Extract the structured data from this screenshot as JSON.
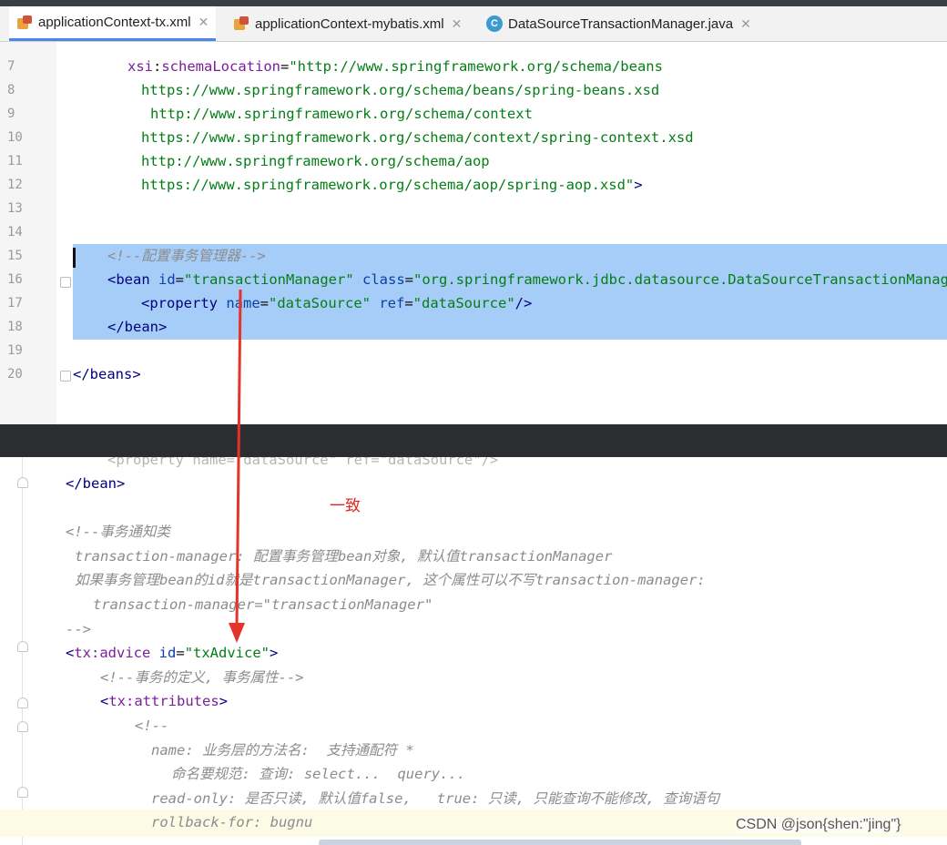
{
  "tabs": [
    {
      "label": "applicationContext-tx.xml",
      "icon": "xml-file-icon",
      "active": true
    },
    {
      "label": "applicationContext-mybatis.xml",
      "icon": "xml-file-icon",
      "active": false
    },
    {
      "label": "DataSourceTransactionManager.java",
      "icon": "java-class-icon",
      "active": false
    }
  ],
  "editor_top": {
    "lines": [
      {
        "num": "7",
        "parts": [
          [
            "c-ns",
            "xsi"
          ],
          [
            "c-pl",
            ":"
          ],
          [
            "c-ns",
            "schemaLocation"
          ],
          [
            "c-pl",
            "="
          ],
          [
            "c-val",
            "\"http://www.springframework.org/schema/beans"
          ]
        ]
      },
      {
        "num": "8",
        "parts": [
          [
            "c-val",
            "https://www.springframework.org/schema/beans/spring-beans.xsd"
          ]
        ]
      },
      {
        "num": "9",
        "parts": [
          [
            "c-val",
            "http://www.springframework.org/schema/context"
          ]
        ]
      },
      {
        "num": "10",
        "parts": [
          [
            "c-val",
            "https://www.springframework.org/schema/context/spring-context.xsd"
          ]
        ]
      },
      {
        "num": "11",
        "parts": [
          [
            "c-val",
            "http://www.springframework.org/schema/aop"
          ]
        ]
      },
      {
        "num": "12",
        "parts": [
          [
            "c-val",
            "https://www.springframework.org/schema/aop/spring-aop.xsd\""
          ],
          [
            "c-tag",
            ">"
          ]
        ]
      },
      {
        "num": "13",
        "parts": []
      },
      {
        "num": "14",
        "parts": []
      },
      {
        "num": "15",
        "parts": [
          [
            "c-com",
            "<!--配置事务管理器-->"
          ]
        ]
      },
      {
        "num": "16",
        "parts": [
          [
            "c-tag",
            "<bean "
          ],
          [
            "c-attr",
            "id"
          ],
          [
            "c-pl",
            "="
          ],
          [
            "c-val",
            "\"transactionManager\""
          ],
          [
            "c-pl",
            " "
          ],
          [
            "c-attr",
            "class"
          ],
          [
            "c-pl",
            "="
          ],
          [
            "c-val",
            "\"org.springframework.jdbc.datasource.DataSourceTransactionManager\""
          ]
        ]
      },
      {
        "num": "17",
        "parts": [
          [
            "c-tag",
            "<property "
          ],
          [
            "c-attr",
            "name"
          ],
          [
            "c-pl",
            "="
          ],
          [
            "c-val",
            "\"dataSource\""
          ],
          [
            "c-pl",
            " "
          ],
          [
            "c-attr",
            "ref"
          ],
          [
            "c-pl",
            "="
          ],
          [
            "c-val",
            "\"dataSource\""
          ],
          [
            "c-tag",
            "/>"
          ]
        ]
      },
      {
        "num": "18",
        "parts": [
          [
            "c-tag",
            "</bean>"
          ]
        ]
      },
      {
        "num": "19",
        "parts": []
      },
      {
        "num": "20",
        "parts": [
          [
            "c-tag",
            "</beans>"
          ]
        ]
      }
    ]
  },
  "editor_bottom": {
    "lines": [
      {
        "parts": [
          [
            "c-tag",
            "</bean>"
          ]
        ]
      },
      {
        "parts": []
      },
      {
        "parts": [
          [
            "c-com",
            "<!--事务通知类"
          ]
        ]
      },
      {
        "parts": [
          [
            "c-com",
            "transaction-manager: 配置事务管理bean对象, 默认值transactionManager"
          ]
        ]
      },
      {
        "parts": [
          [
            "c-com",
            "如果事务管理bean的id就是transactionManager, 这个属性可以不写transaction-manager:"
          ]
        ]
      },
      {
        "parts": [
          [
            "c-com",
            "transaction-manager=\"transactionManager\""
          ]
        ]
      },
      {
        "parts": [
          [
            "c-com",
            "-->"
          ]
        ]
      },
      {
        "parts": [
          [
            "c-tag",
            "<"
          ],
          [
            "c-ns",
            "tx:advice "
          ],
          [
            "c-attr",
            "id"
          ],
          [
            "c-pl",
            "="
          ],
          [
            "c-val",
            "\"txAdvice\""
          ],
          [
            "c-tag",
            ">"
          ]
        ]
      },
      {
        "parts": [
          [
            "c-com",
            "<!--事务的定义, 事务属性-->"
          ]
        ]
      },
      {
        "parts": [
          [
            "c-tag",
            "<"
          ],
          [
            "c-ns",
            "tx:attributes"
          ],
          [
            "c-tag",
            ">"
          ]
        ]
      },
      {
        "parts": [
          [
            "c-com",
            "<!--"
          ]
        ]
      },
      {
        "parts": [
          [
            "c-com",
            "name: 业务层的方法名:  支持通配符 *"
          ]
        ]
      },
      {
        "parts": [
          [
            "c-com",
            "命名要规范: 查询: select...  query..."
          ]
        ]
      },
      {
        "parts": [
          [
            "c-com",
            "read-only: 是否只读, 默认值false,   true: 只读, 只能查询不能修改, 查询语句"
          ]
        ]
      },
      {
        "parts": [
          [
            "c-com",
            "rollback-for: bugnu"
          ]
        ]
      }
    ]
  },
  "annotation": {
    "text": "一致",
    "color": "#e0271f"
  },
  "watermark": {
    "text": "CSDN @json{shen:\"jing\"}"
  }
}
